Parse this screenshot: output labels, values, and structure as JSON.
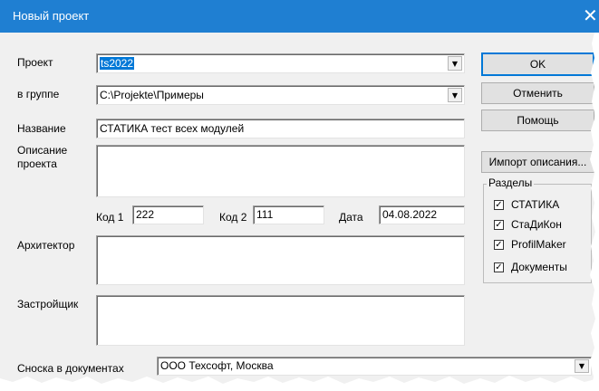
{
  "window": {
    "title": "Новый проект",
    "close_glyph": "✕"
  },
  "form": {
    "project_label": "Проект",
    "project_value": "ts2022",
    "group_label": "в группе",
    "group_value": "C:\\Projekte\\Примеры",
    "name_label": "Название",
    "name_value": "СТАТИКА тест всех модулей",
    "description_label_line1": "Описание",
    "description_label_line2": "проекта",
    "description_value": "",
    "code1_label": "Код 1",
    "code1_value": "222",
    "code2_label": "Код 2",
    "code2_value": "111",
    "date_label": "Дата",
    "date_value": "04.08.2022",
    "architect_label": "Архитектор",
    "architect_value": "",
    "developer_label": "Застройщик",
    "developer_value": "",
    "footnote_label": "Сноска в документах",
    "footnote_value": "ООО Техсофт, Москва"
  },
  "buttons": {
    "ok": "OK",
    "cancel": "Отменить",
    "help": "Помощь",
    "import_description": "Импорт описания..."
  },
  "sections": {
    "title": "Разделы",
    "items": [
      {
        "label": "СТАТИКА",
        "checked": true
      },
      {
        "label": "СтаДиКон",
        "checked": true
      },
      {
        "label": "ProfilMaker",
        "checked": true
      },
      {
        "label": "Документы",
        "checked": true
      }
    ]
  },
  "icons": {
    "dropdown": "dropdown-arrow-icon",
    "checkmark": "checkmark-icon"
  },
  "colors": {
    "titlebar": "#1f7fd2",
    "selection": "#0078d7",
    "default_button_border": "#0078d7",
    "dialog_bg": "#f0f0f0"
  }
}
